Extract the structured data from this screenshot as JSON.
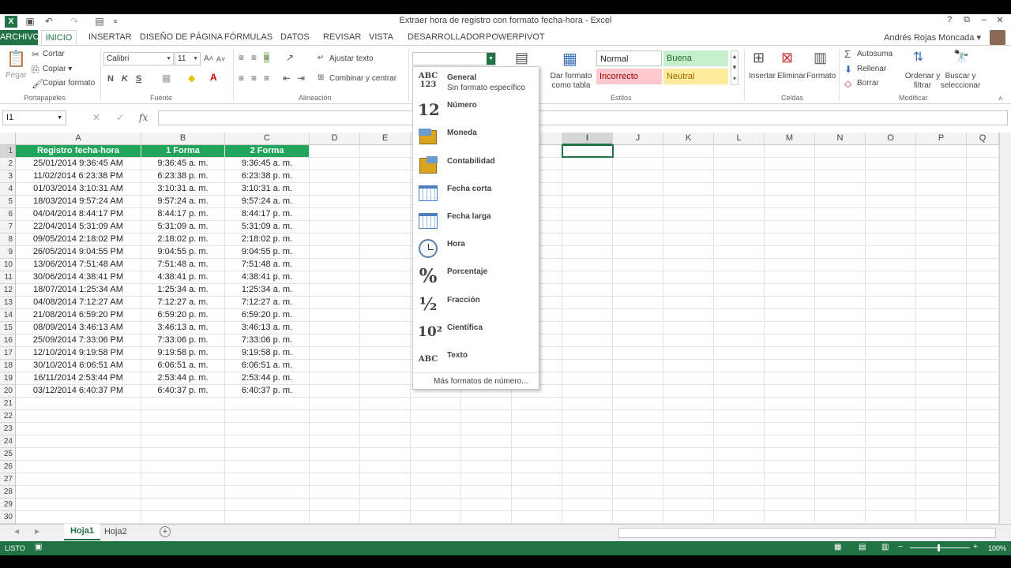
{
  "window": {
    "title": "Extraer hora de registro con formato fecha-hora - Excel",
    "help": "?",
    "restore": "⧉",
    "minimize": "–",
    "maximize": "☐",
    "close": "✕"
  },
  "ribbon_tabs": {
    "archivo": "ARCHIVO",
    "inicio": "INICIO",
    "insertar": "INSERTAR",
    "diseno": "DISEÑO DE PÁGINA",
    "formulas": "FÓRMULAS",
    "datos": "DATOS",
    "revisar": "REVISAR",
    "vista": "VISTA",
    "desarrollador": "DESARROLLADOR",
    "powerpivot": "POWERPIVOT"
  },
  "user": {
    "name": "Andrés Rojas Moncada ▾"
  },
  "clipboard": {
    "paste": "Pegar",
    "cut": "Cortar",
    "copy": "Copiar ▾",
    "format_painter": "Copiar formato",
    "group": "Portapapeles"
  },
  "font": {
    "name": "Calibri",
    "size": "11",
    "bold": "N",
    "italic": "K",
    "underline": "S",
    "group": "Fuente"
  },
  "alignment": {
    "wrap": "Ajustar texto",
    "merge": "Combinar y centrar",
    "group": "Alineación"
  },
  "styles": {
    "format_table": "Dar formato como tabla",
    "normal": "Normal",
    "good": "Buena",
    "bad": "Incorrecto",
    "neutral": "Neutral",
    "group": "Estilos"
  },
  "cells": {
    "insert": "Insertar",
    "delete": "Eliminar",
    "format": "Formato",
    "group": "Celdas"
  },
  "editing": {
    "autosum": "Autosuma",
    "fill": "Rellenar",
    "clear": "Borrar",
    "sort": "Ordenar y filtrar",
    "find": "Buscar y seleccionar",
    "group": "Modificar"
  },
  "formula_bar": {
    "name_box": "I1",
    "fx": "fx",
    "cancel": "✕",
    "enter": "✓"
  },
  "columns": [
    "A",
    "B",
    "C",
    "D",
    "E",
    "F",
    "G",
    "H",
    "I",
    "J",
    "K",
    "L",
    "M",
    "N",
    "O",
    "P",
    "Q"
  ],
  "table": {
    "headers": [
      "Registro fecha-hora",
      "1 Forma",
      "2 Forma"
    ],
    "rows": [
      [
        "25/01/2014 9:36:45 AM",
        "9:36:45 a. m.",
        "9:36:45 a. m."
      ],
      [
        "11/02/2014 6:23:38 PM",
        "6:23:38 p. m.",
        "6:23:38 p. m."
      ],
      [
        "01/03/2014 3:10:31 AM",
        "3:10:31 a. m.",
        "3:10:31 a. m."
      ],
      [
        "18/03/2014 9:57:24 AM",
        "9:57:24 a. m.",
        "9:57:24 a. m."
      ],
      [
        "04/04/2014 8:44:17 PM",
        "8:44:17 p. m.",
        "8:44:17 p. m."
      ],
      [
        "22/04/2014 5:31:09 AM",
        "5:31:09 a. m.",
        "5:31:09 a. m."
      ],
      [
        "09/05/2014 2:18:02 PM",
        "2:18:02 p. m.",
        "2:18:02 p. m."
      ],
      [
        "26/05/2014 9:04:55 PM",
        "9:04:55 p. m.",
        "9:04:55 p. m."
      ],
      [
        "13/06/2014 7:51:48 AM",
        "7:51:48 a. m.",
        "7:51:48 a. m."
      ],
      [
        "30/06/2014 4:38:41 PM",
        "4:38:41 p. m.",
        "4:38:41 p. m."
      ],
      [
        "18/07/2014 1:25:34 AM",
        "1:25:34 a. m.",
        "1:25:34 a. m."
      ],
      [
        "04/08/2014 7:12:27 AM",
        "7:12:27 a. m.",
        "7:12:27 a. m."
      ],
      [
        "21/08/2014 6:59:20 PM",
        "6:59:20 p. m.",
        "6:59:20 p. m."
      ],
      [
        "08/09/2014 3:46:13 AM",
        "3:46:13 a. m.",
        "3:46:13 a. m."
      ],
      [
        "25/09/2014 7:33:06 PM",
        "7:33:06 p. m.",
        "7:33:06 p. m."
      ],
      [
        "12/10/2014 9:19:58 PM",
        "9:19:58 p. m.",
        "9:19:58 p. m."
      ],
      [
        "30/10/2014 6:06:51 AM",
        "6:06:51 a. m.",
        "6:06:51 a. m."
      ],
      [
        "16/11/2014 2:53:44 PM",
        "2:53:44 p. m.",
        "2:53:44 p. m."
      ],
      [
        "03/12/2014 6:40:37 PM",
        "6:40:37 p. m.",
        "6:40:37 p. m."
      ]
    ]
  },
  "row_count": 30,
  "format_menu": {
    "items": [
      {
        "label": "General",
        "sub": "Sin formato específico",
        "icon": "ABC 123"
      },
      {
        "label": "Número",
        "icon": "12"
      },
      {
        "label": "Moneda",
        "icon": "money-icon"
      },
      {
        "label": "Contabilidad",
        "icon": "accounting-icon"
      },
      {
        "label": "Fecha corta",
        "icon": "calendar-icon"
      },
      {
        "label": "Fecha larga",
        "icon": "calendar-icon"
      },
      {
        "label": "Hora",
        "icon": "clock-icon"
      },
      {
        "label": "Porcentaje",
        "icon": "%"
      },
      {
        "label": "Fracción",
        "icon": "½"
      },
      {
        "label": "Científica",
        "icon": "10²"
      },
      {
        "label": "Texto",
        "icon": "ABC"
      }
    ],
    "more": "Más formatos de número..."
  },
  "sheets": {
    "active": "Hoja1",
    "other": "Hoja2",
    "add": "+"
  },
  "status": {
    "mode": "LISTO",
    "zoom": "100%"
  }
}
